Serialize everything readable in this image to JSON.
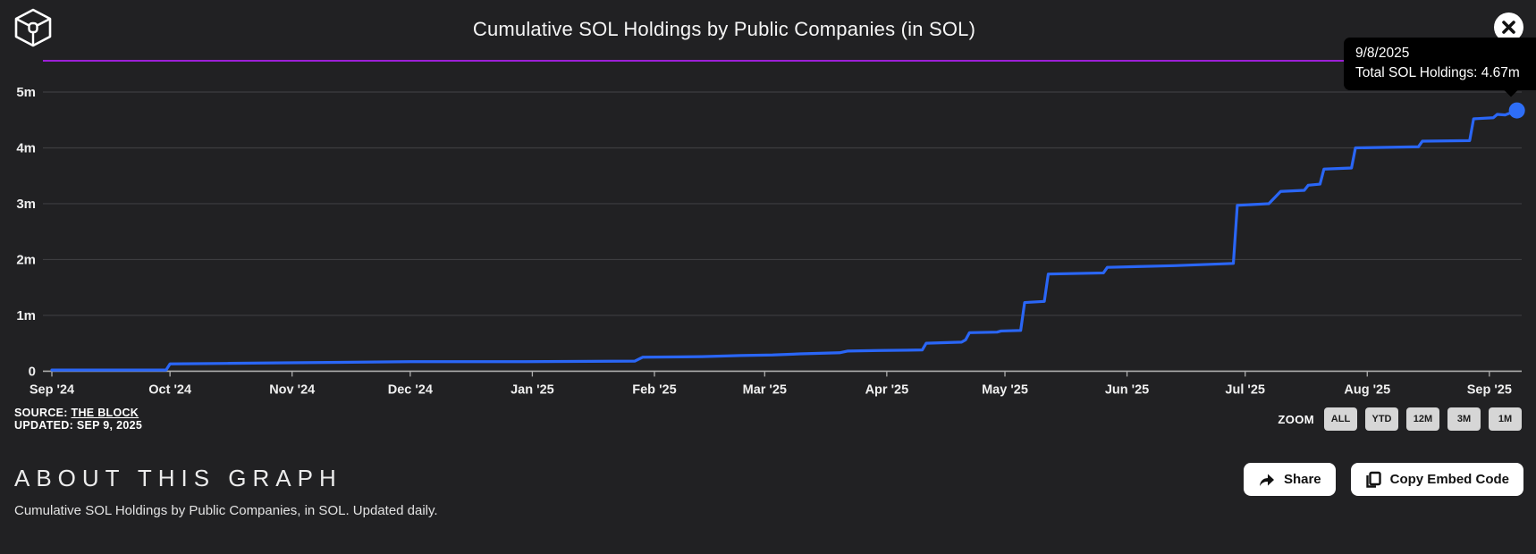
{
  "header": {
    "title": "Cumulative SOL Holdings by Public Companies (in SOL)",
    "logo": "the-block-logo",
    "close": "close"
  },
  "tooltip": {
    "date": "9/8/2025",
    "value_line": "Total SOL Holdings: 4.67m"
  },
  "chart_data": {
    "type": "line",
    "title": "Cumulative SOL Holdings by Public Companies (in SOL)",
    "series_name": "Total SOL Holdings",
    "unit": "millions of SOL",
    "line_color": "#2A66F6",
    "marker_color": "#2E6EF7",
    "accent_rule_color": "#9C1FD6",
    "grid": true,
    "legend": "none",
    "ylim": [
      0,
      5.6
    ],
    "y_ticks": [
      {
        "label": "0",
        "value": 0
      },
      {
        "label": "1m",
        "value": 1
      },
      {
        "label": "2m",
        "value": 2
      },
      {
        "label": "3m",
        "value": 3
      },
      {
        "label": "4m",
        "value": 4
      },
      {
        "label": "5m",
        "value": 5
      }
    ],
    "x_ticks": [
      {
        "label": "Sep '24",
        "day": 0
      },
      {
        "label": "Oct '24",
        "day": 30
      },
      {
        "label": "Nov '24",
        "day": 61
      },
      {
        "label": "Dec '24",
        "day": 91
      },
      {
        "label": "Jan '25",
        "day": 122
      },
      {
        "label": "Feb '25",
        "day": 153
      },
      {
        "label": "Mar '25",
        "day": 181
      },
      {
        "label": "Apr '25",
        "day": 212
      },
      {
        "label": "May '25",
        "day": 242
      },
      {
        "label": "Jun '25",
        "day": 273
      },
      {
        "label": "Jul '25",
        "day": 303
      },
      {
        "label": "Aug '25",
        "day": 334
      },
      {
        "label": "Sep '25",
        "day": 365
      }
    ],
    "points_day_value_m": [
      [
        0,
        0.02
      ],
      [
        29,
        0.02
      ],
      [
        30,
        0.13
      ],
      [
        45,
        0.14
      ],
      [
        60,
        0.15
      ],
      [
        91,
        0.17
      ],
      [
        120,
        0.17
      ],
      [
        148,
        0.18
      ],
      [
        150,
        0.25
      ],
      [
        165,
        0.26
      ],
      [
        175,
        0.28
      ],
      [
        183,
        0.29
      ],
      [
        190,
        0.31
      ],
      [
        200,
        0.33
      ],
      [
        202,
        0.36
      ],
      [
        210,
        0.37
      ],
      [
        221,
        0.38
      ],
      [
        222,
        0.5
      ],
      [
        231,
        0.52
      ],
      [
        232,
        0.56
      ],
      [
        233,
        0.69
      ],
      [
        240,
        0.7
      ],
      [
        241,
        0.72
      ],
      [
        246,
        0.73
      ],
      [
        247,
        1.23
      ],
      [
        252,
        1.25
      ],
      [
        253,
        1.74
      ],
      [
        267,
        1.76
      ],
      [
        268,
        1.86
      ],
      [
        285,
        1.89
      ],
      [
        300,
        1.93
      ],
      [
        301,
        2.97
      ],
      [
        309,
        3.0
      ],
      [
        312,
        3.22
      ],
      [
        318,
        3.24
      ],
      [
        319,
        3.33
      ],
      [
        322,
        3.35
      ],
      [
        323,
        3.62
      ],
      [
        330,
        3.64
      ],
      [
        331,
        4.0
      ],
      [
        347,
        4.02
      ],
      [
        348,
        4.12
      ],
      [
        360,
        4.13
      ],
      [
        361,
        4.52
      ],
      [
        366,
        4.54
      ],
      [
        367,
        4.6
      ],
      [
        369,
        4.59
      ],
      [
        372,
        4.67
      ]
    ],
    "last_point": {
      "date": "9/8/2025",
      "value_m": 4.67
    }
  },
  "source": {
    "prefix": "SOURCE: ",
    "link": "THE BLOCK",
    "updated": "UPDATED: SEP 9, 2025"
  },
  "zoom": {
    "label": "ZOOM",
    "buttons": [
      "ALL",
      "YTD",
      "12M",
      "3M",
      "1M"
    ]
  },
  "about": {
    "heading": "ABOUT THIS GRAPH",
    "description": "Cumulative SOL Holdings by Public Companies, in SOL. Updated daily."
  },
  "actions": {
    "share": "Share",
    "copy_embed": "Copy Embed Code"
  },
  "colors": {
    "background": "#212123",
    "gridline": "#3d3d40",
    "axis": "#aeaeae",
    "label": "#efefef",
    "tooltip_bg": "#000000"
  }
}
